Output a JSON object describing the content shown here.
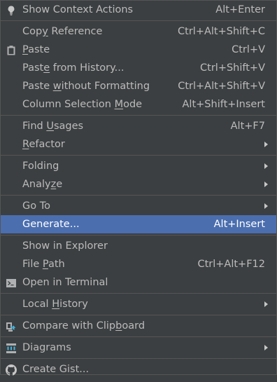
{
  "menu": {
    "groups": [
      [
        {
          "label": "Show Context Actions",
          "mnemonic": "",
          "shortcut": "Alt+Enter",
          "submenu": false,
          "icon": "lightbulb-icon"
        }
      ],
      [
        {
          "label": "Copy Reference",
          "mnemonic": "y",
          "shortcut": "Ctrl+Alt+Shift+C",
          "submenu": false,
          "icon": ""
        },
        {
          "label": "Paste",
          "mnemonic": "P",
          "shortcut": "Ctrl+V",
          "submenu": false,
          "icon": "clipboard-icon"
        },
        {
          "label": "Paste from History...",
          "mnemonic": "e",
          "shortcut": "Ctrl+Shift+V",
          "submenu": false,
          "icon": ""
        },
        {
          "label": "Paste without Formatting",
          "mnemonic": "w",
          "shortcut": "Ctrl+Alt+Shift+V",
          "submenu": false,
          "icon": ""
        },
        {
          "label": "Column Selection Mode",
          "mnemonic": "M",
          "shortcut": "Alt+Shift+Insert",
          "submenu": false,
          "icon": ""
        }
      ],
      [
        {
          "label": "Find Usages",
          "mnemonic": "U",
          "shortcut": "Alt+F7",
          "submenu": false,
          "icon": ""
        },
        {
          "label": "Refactor",
          "mnemonic": "R",
          "shortcut": "",
          "submenu": true,
          "icon": ""
        }
      ],
      [
        {
          "label": "Folding",
          "mnemonic": "",
          "shortcut": "",
          "submenu": true,
          "icon": ""
        },
        {
          "label": "Analyze",
          "mnemonic": "z",
          "shortcut": "",
          "submenu": true,
          "icon": ""
        }
      ],
      [
        {
          "label": "Go To",
          "mnemonic": "",
          "shortcut": "",
          "submenu": true,
          "icon": ""
        },
        {
          "label": "Generate...",
          "mnemonic": "",
          "shortcut": "Alt+Insert",
          "submenu": false,
          "icon": "",
          "selected": true
        }
      ],
      [
        {
          "label": "Show in Explorer",
          "mnemonic": "",
          "shortcut": "",
          "submenu": false,
          "icon": ""
        },
        {
          "label": "File Path",
          "mnemonic": "P",
          "shortcut": "Ctrl+Alt+F12",
          "submenu": false,
          "icon": ""
        },
        {
          "label": "Open in Terminal",
          "mnemonic": "",
          "shortcut": "",
          "submenu": false,
          "icon": "terminal-icon"
        }
      ],
      [
        {
          "label": "Local History",
          "mnemonic": "H",
          "shortcut": "",
          "submenu": true,
          "icon": ""
        }
      ],
      [
        {
          "label": "Compare with Clipboard",
          "mnemonic": "b",
          "shortcut": "",
          "submenu": false,
          "icon": "compare-icon"
        }
      ],
      [
        {
          "label": "Diagrams",
          "mnemonic": "",
          "shortcut": "",
          "submenu": true,
          "icon": "diagram-icon"
        }
      ],
      [
        {
          "label": "Create Gist...",
          "mnemonic": "",
          "shortcut": "",
          "submenu": false,
          "icon": "github-icon"
        }
      ]
    ]
  },
  "colors": {
    "background": "#3c3f41",
    "text": "#bbbbbb",
    "selection": "#4b6eaf",
    "separator": "#555555"
  }
}
